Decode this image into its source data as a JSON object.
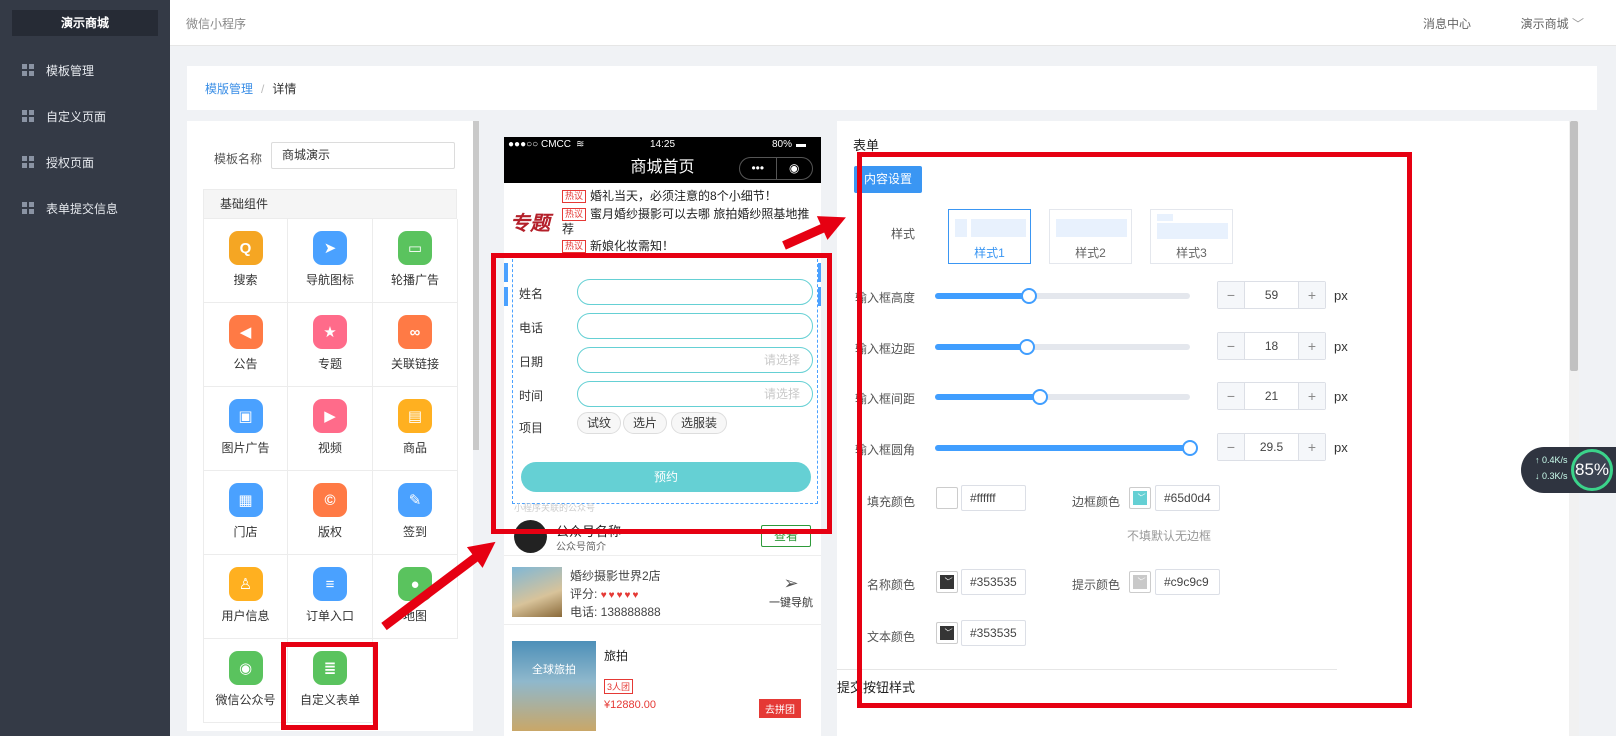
{
  "sidebar": {
    "brand": "演示商城",
    "items": [
      {
        "label": "模板管理"
      },
      {
        "label": "自定义页面"
      },
      {
        "label": "授权页面"
      },
      {
        "label": "表单提交信息"
      }
    ]
  },
  "topbar": {
    "title": "微信小程序",
    "messages": "消息中心",
    "user": "演示商城"
  },
  "breadcrumb": {
    "parent": "模版管理",
    "sep": "/",
    "current": "详情"
  },
  "left": {
    "name_label": "模板名称",
    "name_value": "商城演示",
    "components_title": "基础组件",
    "components": [
      {
        "label": "搜索",
        "icon": "search-icon",
        "color": "#f5a623",
        "glyph": "Q"
      },
      {
        "label": "导航图标",
        "icon": "navigation-icon",
        "color": "#4aa1ff",
        "glyph": "➤"
      },
      {
        "label": "轮播广告",
        "icon": "carousel-icon",
        "color": "#5ac35e",
        "glyph": "▭"
      },
      {
        "label": "公告",
        "icon": "announcement-icon",
        "color": "#ff7a45",
        "glyph": "◀"
      },
      {
        "label": "专题",
        "icon": "topic-icon",
        "color": "#ff6b8a",
        "glyph": "★"
      },
      {
        "label": "关联链接",
        "icon": "link-icon",
        "color": "#ff7a45",
        "glyph": "∞"
      },
      {
        "label": "图片广告",
        "icon": "image-icon",
        "color": "#4aa1ff",
        "glyph": "▣"
      },
      {
        "label": "视频",
        "icon": "video-icon",
        "color": "#ff6b8a",
        "glyph": "▶"
      },
      {
        "label": "商品",
        "icon": "shopping-bag-icon",
        "color": "#ffb020",
        "glyph": "▤"
      },
      {
        "label": "门店",
        "icon": "store-icon",
        "color": "#4aa1ff",
        "glyph": "▦"
      },
      {
        "label": "版权",
        "icon": "copyright-icon",
        "color": "#ff7a45",
        "glyph": "©"
      },
      {
        "label": "签到",
        "icon": "pencil-icon",
        "color": "#4aa1ff",
        "glyph": "✎"
      },
      {
        "label": "用户信息",
        "icon": "user-info-icon",
        "color": "#ffb020",
        "glyph": "♙"
      },
      {
        "label": "订单入口",
        "icon": "order-icon",
        "color": "#4aa1ff",
        "glyph": "≡"
      },
      {
        "label": "地图",
        "icon": "map-icon",
        "color": "#5ac35e",
        "glyph": "●"
      },
      {
        "label": "微信公众号",
        "icon": "wechat-icon",
        "color": "#5ac35e",
        "glyph": "◉"
      },
      {
        "label": "自定义表单",
        "icon": "custom-form-icon",
        "color": "#5ac35e",
        "glyph": "≣"
      }
    ]
  },
  "preview": {
    "carrier": "●●●○○ CMCC",
    "time": "14:25",
    "battery": "80%",
    "page_title": "商城首页",
    "capsule_more": "•••",
    "capsule_close": "◉",
    "topic_logo": "专题",
    "hot_tag": "热议",
    "topic_lines": [
      "婚礼当天，必须注意的8个小细节！",
      "蜜月婚纱摄影可以去哪 旅拍婚纱照基地推荐",
      "新娘化妆需知！"
    ],
    "form": {
      "fields": [
        {
          "label": "姓名",
          "placeholder": ""
        },
        {
          "label": "电话",
          "placeholder": ""
        },
        {
          "label": "日期",
          "placeholder": "请选择"
        },
        {
          "label": "时间",
          "placeholder": "请选择"
        }
      ],
      "options_label": "项目",
      "options": [
        "试纹",
        "选片",
        "选服装"
      ],
      "submit": "预约"
    },
    "faint_text": "小程序关联的公众号",
    "pubw": {
      "name": "公众号名称",
      "desc": "公众号简介",
      "button": "查看"
    },
    "store": {
      "name": "婚纱摄影世界2店",
      "rating_label": "评分:",
      "hearts": "♥♥♥♥♥",
      "phone": "电话: 138888888",
      "nav": "一键导航"
    },
    "trip": {
      "image_text": "全球旅拍",
      "title": "旅拍",
      "group": "3人团",
      "price": "¥12880.00",
      "btn": "去拼团"
    }
  },
  "right": {
    "section_title": "表单",
    "tab": "内容设置",
    "style_label": "样式",
    "styles": [
      "样式1",
      "样式2",
      "样式3"
    ],
    "sliders": [
      {
        "label": "输入框高度",
        "value": "59",
        "pct": 0.37
      },
      {
        "label": "输入框边距",
        "value": "18",
        "pct": 0.36
      },
      {
        "label": "输入框间距",
        "value": "21",
        "pct": 0.41
      },
      {
        "label": "输入框圆角",
        "value": "29.5",
        "pct": 1.0
      }
    ],
    "unit": "px",
    "minus": "−",
    "plus": "+",
    "colors": {
      "fill_label": "填充颜色",
      "fill": "#ffffff",
      "border_label": "边框颜色",
      "border": "#65d0d4",
      "border_hint": "不填默认无边框",
      "name_label": "名称颜色",
      "name": "#353535",
      "hint_label": "提示颜色",
      "hint": "#c9c9c9",
      "text_label": "文本颜色",
      "text": "#353535"
    },
    "next_section": "提交按钮样式"
  },
  "speed": {
    "up": "↑ 0.4K/s",
    "down": "↓ 0.3K/s",
    "pct": "85%"
  }
}
